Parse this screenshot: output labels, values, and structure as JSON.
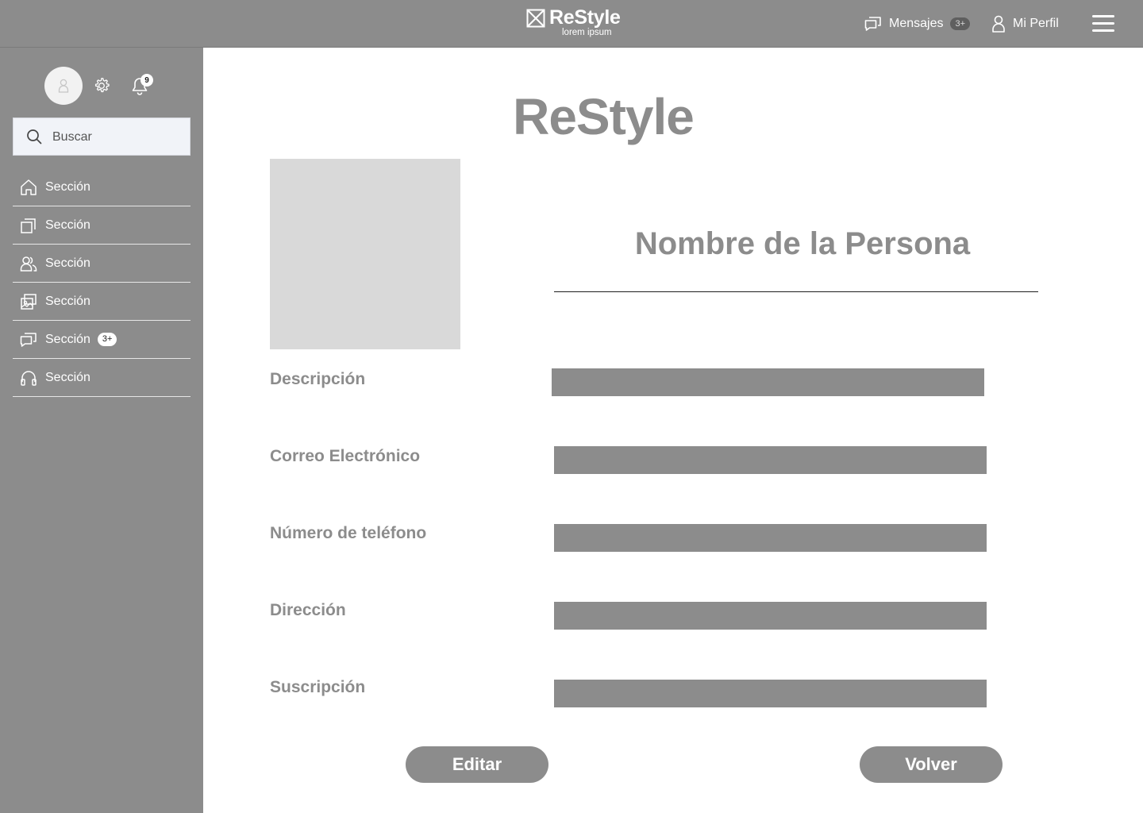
{
  "brand": {
    "name": "ReStyle",
    "tagline": "lorem ipsum"
  },
  "header": {
    "messages_label": "Mensajes",
    "messages_badge": "3+",
    "profile_label": "Mi Perfil"
  },
  "sidebar": {
    "notification_count": "9",
    "search": {
      "placeholder": "Buscar"
    },
    "items": [
      {
        "label": "Sección",
        "icon": "home-icon"
      },
      {
        "label": "Sección",
        "icon": "pages-icon"
      },
      {
        "label": "Sección",
        "icon": "users-icon"
      },
      {
        "label": "Sección",
        "icon": "gallery-icon"
      },
      {
        "label": "Sección",
        "icon": "chat-icon",
        "badge": "3+"
      },
      {
        "label": "Sección",
        "icon": "headphones-icon"
      }
    ]
  },
  "main": {
    "title": "ReStyle",
    "person_name": "Nombre de la Persona",
    "fields": [
      {
        "label": "Descripción"
      },
      {
        "label": "Correo Electrónico"
      },
      {
        "label": "Número de teléfono"
      },
      {
        "label": "Dirección"
      },
      {
        "label": "Suscripción"
      }
    ],
    "edit_button": "Editar",
    "back_button": "Volver"
  },
  "colors": {
    "chrome": "#8c8c8c",
    "placeholder_block": "#d9d9d9",
    "search_bg": "#f1f3f8"
  }
}
